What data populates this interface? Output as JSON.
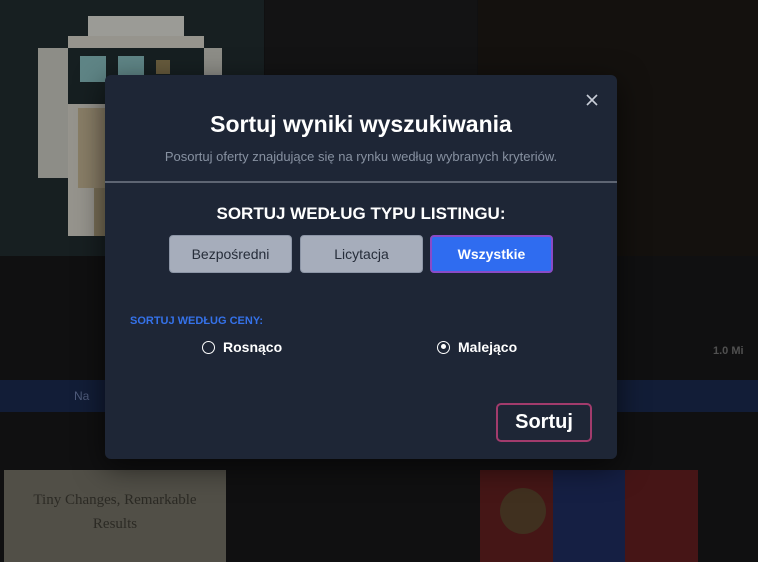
{
  "background": {
    "strip_text_left": "Na",
    "strip_text_right": "",
    "side_label": "1.0 Mi",
    "thumb_text": "Tiny Changes, Remarkable Results"
  },
  "modal": {
    "close_icon": "close-icon",
    "title": "Sortuj wyniki wyszukiwania",
    "subtitle": "Posortuj oferty znajdujące się na rynku według wybranych kryteriów.",
    "listing_heading": "SORTUJ WEDŁUG TYPU LISTINGU:",
    "listing_types": [
      {
        "label": "Bezpośredni",
        "selected": false
      },
      {
        "label": "Licytacja",
        "selected": false
      },
      {
        "label": "Wszystkie",
        "selected": true
      }
    ],
    "price_heading": "SORTUJ WEDŁUG CENY:",
    "price_options": [
      {
        "label": "Rosnąco",
        "selected": false
      },
      {
        "label": "Malejąco",
        "selected": true
      }
    ],
    "submit_label": "Sortuj"
  },
  "colors": {
    "modal_bg": "#1e2636",
    "accent_blue": "#2f6cf0",
    "price_label": "#3572ea",
    "submit_border": "#a23b6c"
  }
}
